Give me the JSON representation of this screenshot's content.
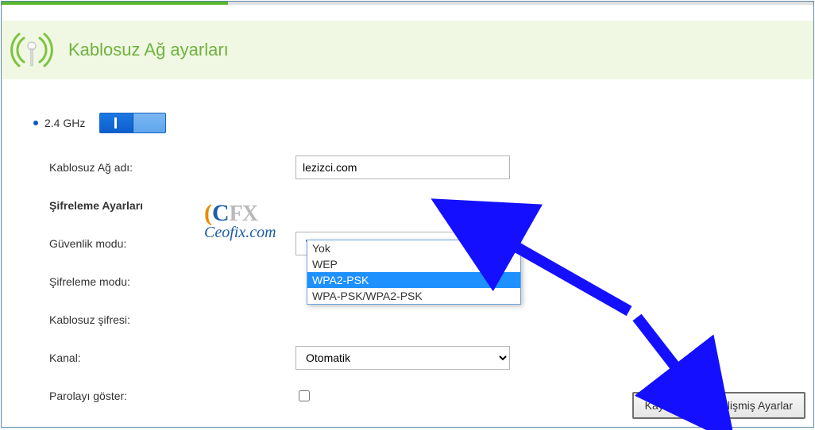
{
  "header": {
    "title": "Kablosuz Ağ ayarları"
  },
  "band": {
    "label": "2.4 GHz",
    "enabled": true
  },
  "form": {
    "ssid_label": "Kablosuz Ağ adı:",
    "ssid_value": "lezizci.com",
    "encryption_heading": "Şifreleme Ayarları",
    "security_mode_label": "Güvenlik modu:",
    "security_mode_value": "WPA2-PSK",
    "security_mode_options": [
      "Yok",
      "WEP",
      "WPA2-PSK",
      "WPA-PSK/WPA2-PSK"
    ],
    "encryption_mode_label": "Şifreleme modu:",
    "wireless_password_label": "Kablosuz şifresi:",
    "channel_label": "Kanal:",
    "channel_value": "Otomatik",
    "show_password_label": "Parolayı göster:"
  },
  "watermark": {
    "top": "CFX",
    "site": "Ceofix.com"
  },
  "buttons": {
    "save": "Kaydet",
    "advanced": "Gelişmiş Ayarlar"
  },
  "colors": {
    "accent_green": "#6fb33f",
    "arrow_blue": "#1410ff",
    "dropdown_highlight": "#1e90ff"
  }
}
